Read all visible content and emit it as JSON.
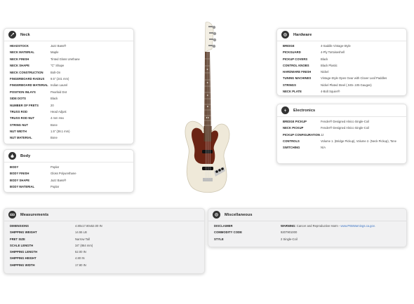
{
  "sections": {
    "neck": {
      "title": "Neck",
      "icon": "guitar-neck-icon",
      "rows": [
        {
          "label": "HEADSTOCK",
          "value": "Jazz Bass®"
        },
        {
          "label": "NECK MATERIAL",
          "value": "Maple"
        },
        {
          "label": "NECK FINISH",
          "value": "Tinted Gloss Urethane"
        },
        {
          "label": "NECK SHAPE",
          "value": "\"C\" Shape"
        },
        {
          "label": "NECK CONSTRUCTION",
          "value": "Bolt-On"
        },
        {
          "label": "FINGERBOARD RADIUS",
          "value": "9.5\" (241 mm)"
        },
        {
          "label": "FINGERBOARD MATERIAL",
          "value": "Indian Laurel"
        },
        {
          "label": "POSITION INLAYS",
          "value": "Pearloid Dot"
        },
        {
          "label": "SIDE DOTS",
          "value": "Black"
        },
        {
          "label": "NUMBER OF FRETS",
          "value": "20"
        },
        {
          "label": "TRUSS ROD",
          "value": "Head Adjust"
        },
        {
          "label": "TRUSS ROD NUT",
          "value": "4 mm Hex"
        },
        {
          "label": "STRING NUT",
          "value": "Bone"
        },
        {
          "label": "NUT WIDTH",
          "value": "1.5\" (38.1 mm)"
        },
        {
          "label": "NUT MATERIAL",
          "value": "Bone"
        }
      ]
    },
    "body": {
      "title": "Body",
      "icon": "guitar-body-icon",
      "rows": [
        {
          "label": "BODY",
          "value": "Poplar"
        },
        {
          "label": "BODY FINISH",
          "value": "Gloss Polyurethane"
        },
        {
          "label": "BODY SHAPE",
          "value": "Jazz Bass®"
        },
        {
          "label": "BODY MATERIAL",
          "value": "Poplar"
        }
      ]
    },
    "hardware": {
      "title": "Hardware",
      "icon": "gear-icon",
      "rows": [
        {
          "label": "BRIDGE",
          "value": "4-Saddle Vintage-Style"
        },
        {
          "label": "PICKGUARD",
          "value": "4-Ply Tortoiseshell"
        },
        {
          "label": "PICKUP COVERS",
          "value": "Black"
        },
        {
          "label": "CONTROL KNOBS",
          "value": "Black Plastic"
        },
        {
          "label": "HARDWARE FINISH",
          "value": "Nickel"
        },
        {
          "label": "TUNING MACHINES",
          "value": "Vintage-Style Open Gear with Clover Leaf Paddles"
        },
        {
          "label": "STRINGS",
          "value": "Nickel Plated Steel (.045-.105 Gauges)"
        },
        {
          "label": "NECK PLATE",
          "value": "4-Bolt Squier®"
        }
      ]
    },
    "electronics": {
      "title": "Electronics",
      "icon": "electronics-icon",
      "rows": [
        {
          "label": "BRIDGE PICKUP",
          "value": "Fender® Designed Alnico Single-Coil"
        },
        {
          "label": "NECK PICKUP",
          "value": "Fender® Designed Alnico Single-Coil"
        },
        {
          "label": "PICKUP CONFIGURATION",
          "value": "JJ"
        },
        {
          "label": "CONTROLS",
          "value": "Volume 1. (Bridge Pickup), Volume 2. (Neck Pickup), Tone"
        },
        {
          "label": "SWITCHING",
          "value": "N/A"
        }
      ]
    },
    "measurements": {
      "title": "Measurements",
      "icon": "ruler-icon",
      "rows": [
        {
          "label": "DIMENSIONS",
          "value": "4.80x17.80x52.00 IN"
        },
        {
          "label": "SHIPPING WEIGHT",
          "value": "14.55 LB"
        },
        {
          "label": "FRET SIZE",
          "value": "Narrow Tall"
        },
        {
          "label": "SCALE LENGTH",
          "value": "34\" (864 mm)"
        },
        {
          "label": "SHIPPING LENGTH",
          "value": "52.00 IN"
        },
        {
          "label": "SHIPPING HEIGHT",
          "value": "4.80 IN"
        },
        {
          "label": "SHIPPING WIDTH",
          "value": "17.80 IN"
        }
      ]
    },
    "misc": {
      "title": "Miscellaneous",
      "icon": "gear-icon",
      "disclaimer_label": "DISCLAIMER",
      "disclaimer_warning": "WARNING:",
      "disclaimer_text": " Cancer and Reproductive Harm - ",
      "disclaimer_link": "www.P65Warnings.ca.gov.",
      "commodity_label": "COMMODITY CODE",
      "commodity_value": "9207901000",
      "style_label": "STYLE",
      "style_value": "2 Single-Coil"
    }
  },
  "product_image": {
    "icon": "jazz-bass-guitar-image",
    "body_color": "#efe9d9",
    "pickguard_color": "#6b2414",
    "fingerboard_color": "#5a3a26"
  }
}
